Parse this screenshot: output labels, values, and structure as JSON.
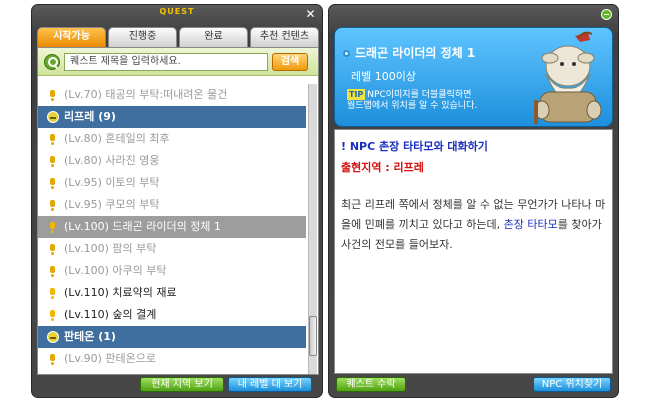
{
  "quest_window": {
    "title": "QUEST",
    "tabs": [
      {
        "label": "시작가능",
        "active": true
      },
      {
        "label": "진행중",
        "active": false
      },
      {
        "label": "완료",
        "active": false
      },
      {
        "label": "추천 컨텐츠",
        "active": false
      }
    ],
    "search": {
      "placeholder": "퀘스트 제목을 입력하세요.",
      "button": "검색"
    },
    "list": [
      {
        "text": "(Lv.70) 태공의 부탁:떠내려온 물건",
        "kind": "quest",
        "style": "gray"
      },
      {
        "text": "리프레 (9)",
        "kind": "area"
      },
      {
        "text": "(Lv.80) 혼테일의 최후",
        "kind": "quest",
        "style": "gray"
      },
      {
        "text": "(Lv.80) 사라진 영웅",
        "kind": "quest",
        "style": "gray"
      },
      {
        "text": "(Lv.95) 이토의 부탁",
        "kind": "quest",
        "style": "gray"
      },
      {
        "text": "(Lv.95) 쿠모의 부탁",
        "kind": "quest",
        "style": "gray"
      },
      {
        "text": "(Lv.100) 드래곤 라이더의 정체 1",
        "kind": "quest",
        "style": "sel"
      },
      {
        "text": "(Lv.100) 팜의 부탁",
        "kind": "quest",
        "style": "gray"
      },
      {
        "text": "(Lv.100) 아쿠의 부탁",
        "kind": "quest",
        "style": "gray"
      },
      {
        "text": "(Lv.110) 치료약의 재료",
        "kind": "quest",
        "style": "dark"
      },
      {
        "text": "(Lv.110) 숲의 결계",
        "kind": "quest",
        "style": "dark"
      },
      {
        "text": "판테온 (1)",
        "kind": "area"
      },
      {
        "text": "(Lv.90) 판테온으로",
        "kind": "quest",
        "style": "gray"
      }
    ],
    "buttons": {
      "current_area": "현재 지역 보기",
      "my_level": "내 레벨 대 보기"
    }
  },
  "detail_window": {
    "quest_title": "드래곤 라이더의 정체 1",
    "level_req": "레벨 100이상",
    "tip_badge": "TIP",
    "tip_line1": "NPC이미지를 더블클릭하면",
    "tip_line2": "월드맵에서 위치를 알 수 있습니다.",
    "npc_line": "! NPC 촌장 타타모와 대화하기",
    "region_line": "출현지역 : 리프레",
    "desc_part1": "최근 리프레 쪽에서 정체를 알 수 없는 무언가가 나타나 마을에 민폐를 끼치고 있다고 하는데, ",
    "desc_highlight": "촌장 타타모",
    "desc_part2": "를 찾아가 사건의 전모를 들어보자.",
    "buttons": {
      "accept": "퀘스트 수락",
      "npc_location": "NPC 위치찾기"
    }
  }
}
